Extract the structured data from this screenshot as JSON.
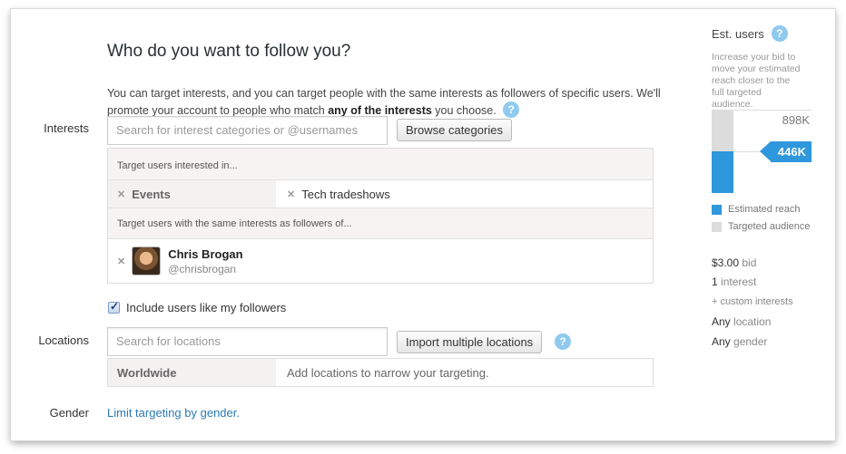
{
  "header": {
    "title": "Who do you want to follow you?"
  },
  "description": {
    "part1": "You can target interests, and you can target people with the same interests as followers of specific users. We'll promote your account to people who match ",
    "bold": "any of the interests",
    "part2": " you choose."
  },
  "interests": {
    "label": "Interests",
    "search_placeholder": "Search for interest categories or @usernames",
    "browse_label": "Browse categories",
    "interested_header": "Target users interested in...",
    "interest_tags": [
      "Events",
      "Tech tradeshows"
    ],
    "followers_header": "Target users with the same interests as followers of...",
    "user": {
      "name": "Chris Brogan",
      "handle": "@chrisbrogan"
    },
    "include_followers_label": "Include users like my followers",
    "include_followers_checked": true
  },
  "locations": {
    "label": "Locations",
    "search_placeholder": "Search for locations",
    "import_label": "Import multiple locations",
    "selected": "Worldwide",
    "hint": "Add locations to narrow your targeting."
  },
  "gender": {
    "label": "Gender",
    "link": "Limit targeting by gender."
  },
  "sidebar": {
    "title": "Est. users",
    "note": "Increase your bid to move your estimated reach closer to the full targeted audience.",
    "targeted_value": "898K",
    "estimated_value": "446K",
    "estimated_fraction": 0.5,
    "legend_estimated": "Estimated reach",
    "legend_targeted": "Targeted audience",
    "estimated_color": "#2f97dc",
    "targeted_color": "#dcdcdc",
    "bid_amount": "$3.00",
    "bid_label": "bid",
    "interest_count": "1",
    "interest_label": "interest",
    "custom_interests": "+ custom interests",
    "location_any": "Any",
    "location_label": "location",
    "gender_any": "Any",
    "gender_label": "gender"
  }
}
